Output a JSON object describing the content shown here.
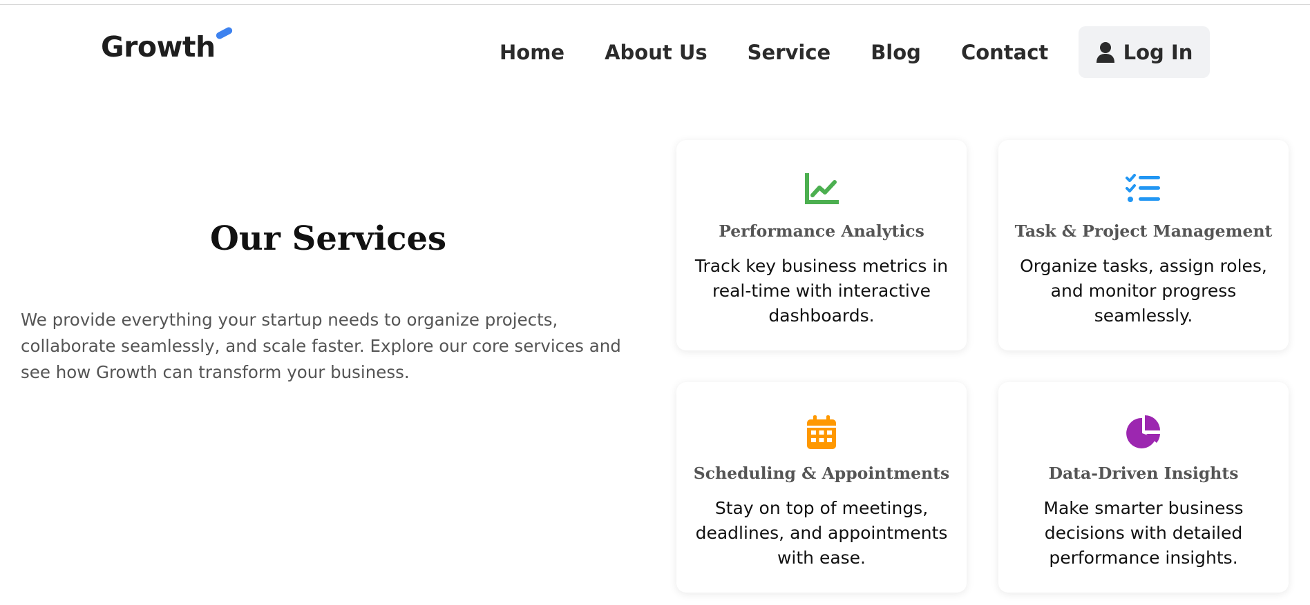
{
  "header": {
    "logo": "Growth",
    "nav": [
      "Home",
      "About Us",
      "Service",
      "Blog",
      "Contact"
    ],
    "login_label": "Log In",
    "login_icon": "user-icon"
  },
  "intro": {
    "title": "Our Services",
    "description": "We provide everything your startup needs to organize projects, collaborate seamlessly, and scale faster. Explore our core services and see how Growth can transform your business."
  },
  "services": [
    {
      "icon": "chart-line-icon",
      "icon_color": "#4caf50",
      "title": "Performance Analytics",
      "text": "Track key business metrics in real-time with interactive dashboards."
    },
    {
      "icon": "tasks-list-icon",
      "icon_color": "#2196f3",
      "title": "Task & Project Management",
      "text": "Organize tasks, assign roles, and monitor progress seamlessly."
    },
    {
      "icon": "calendar-icon",
      "icon_color": "#ff9800",
      "title": "Scheduling & Appointments",
      "text": "Stay on top of meetings, deadlines, and appointments with ease."
    },
    {
      "icon": "pie-chart-icon",
      "icon_color": "#9c27b0",
      "title": "Data-Driven Insights",
      "text": "Make smarter business decisions with detailed performance insights."
    }
  ],
  "colors": {
    "logo_accent": "#3d82ef",
    "login_bg": "#f1f2f4"
  }
}
